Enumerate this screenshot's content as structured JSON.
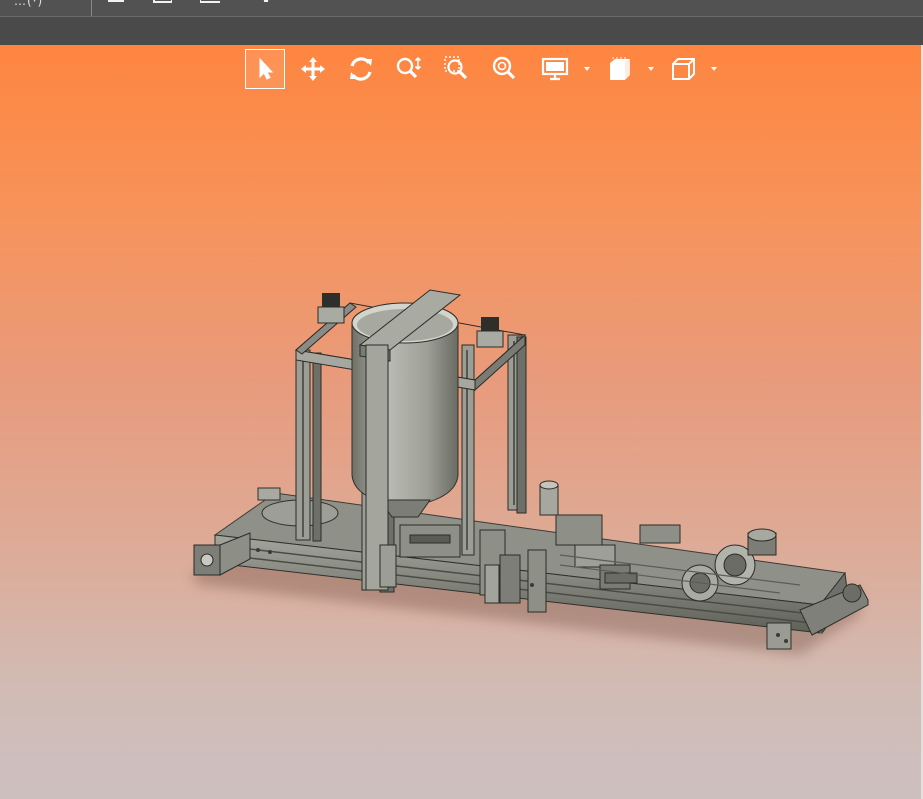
{
  "topbar": {
    "truncated_label": "…(·)",
    "icons": [
      "save-icon",
      "save-as-icon",
      "print-icon",
      "settings-icon"
    ]
  },
  "view_toolbar": {
    "tools": [
      {
        "name": "select-icon",
        "active": true
      },
      {
        "name": "pan-icon",
        "active": false
      },
      {
        "name": "rotate-icon",
        "active": false
      },
      {
        "name": "zoom-icon",
        "active": false
      },
      {
        "name": "zoom-window-icon",
        "active": false
      },
      {
        "name": "zoom-fit-icon",
        "active": false
      },
      {
        "name": "display-mode-icon",
        "active": false,
        "has_dropdown": true
      },
      {
        "name": "section-view-icon",
        "active": false,
        "has_dropdown": true
      },
      {
        "name": "standard-views-icon",
        "active": false,
        "has_dropdown": true
      }
    ]
  },
  "colors": {
    "toolbar_bg": "#525252",
    "viewport_top": "#fe8540",
    "viewport_bottom": "#cdbfc0",
    "model_metal": "#8c8d84",
    "icon_white": "#ffffff"
  }
}
